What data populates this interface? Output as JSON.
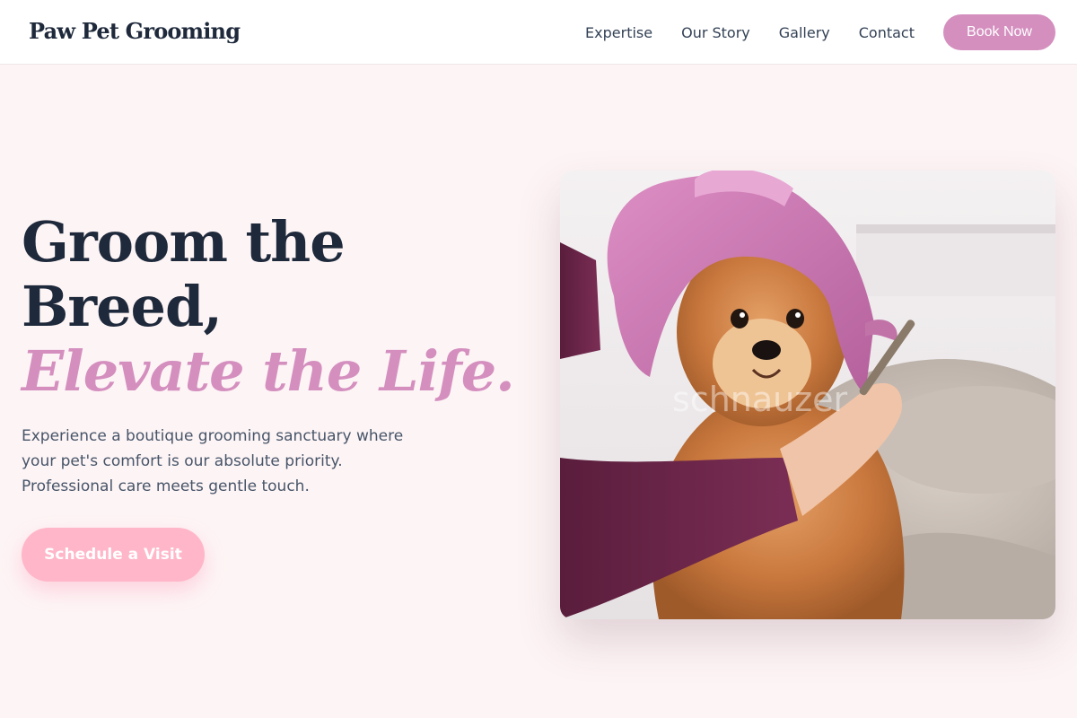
{
  "header": {
    "logo": "Paw Pet Grooming",
    "nav": [
      "Expertise",
      "Our Story",
      "Gallery",
      "Contact"
    ],
    "book_label": "Book Now"
  },
  "hero": {
    "title_line1": "Groom the",
    "title_line2": "Breed,",
    "title_accent": "Elevate the Life.",
    "description": "Experience a boutique grooming sanctuary where your pet's comfort is our absolute priority. Professional care meets gentle touch.",
    "cta_label": "Schedule a Visit",
    "image_watermark": "schnauzer"
  },
  "colors": {
    "page_background": "#fdf4f5",
    "accent": "#d48fbf",
    "cta": "#ffb6c8",
    "heading": "#1e293b"
  }
}
